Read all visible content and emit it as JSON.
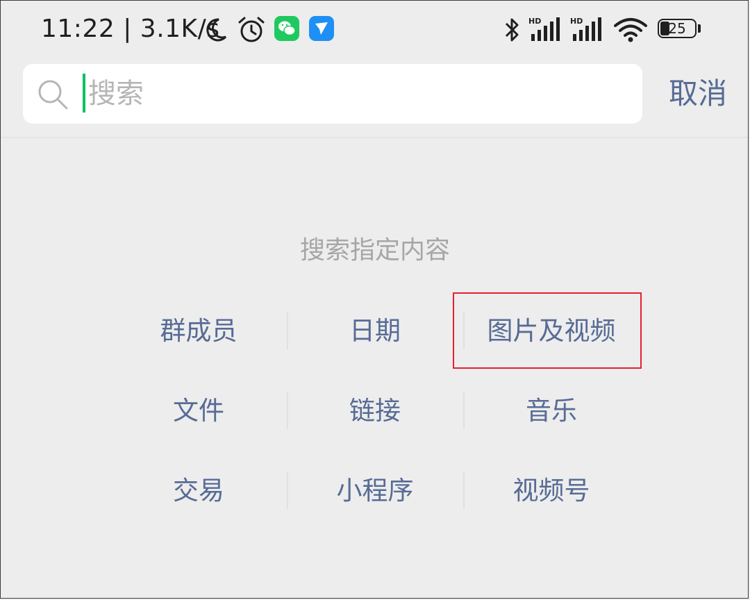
{
  "status_bar": {
    "time": "11:22",
    "separator": "|",
    "net_speed": "3.1K/s",
    "battery_level": "25",
    "icons": [
      "moon-icon",
      "alarm-icon",
      "wechat-icon",
      "feishu-icon",
      "bluetooth-icon",
      "signal-hd-icon",
      "signal-hd-icon",
      "wifi-icon",
      "battery-icon"
    ]
  },
  "search": {
    "placeholder": "搜索",
    "value": "",
    "cancel_label": "取消"
  },
  "section": {
    "title": "搜索指定内容"
  },
  "categories": [
    [
      "群成员",
      "日期",
      "图片及视频"
    ],
    [
      "文件",
      "链接",
      "音乐"
    ],
    [
      "交易",
      "小程序",
      "视频号"
    ]
  ],
  "highlighted": "图片及视频",
  "colors": {
    "accent_link": "#576b95",
    "cursor_green": "#07c160",
    "highlight_red": "#e8202e",
    "background": "#ededed"
  }
}
